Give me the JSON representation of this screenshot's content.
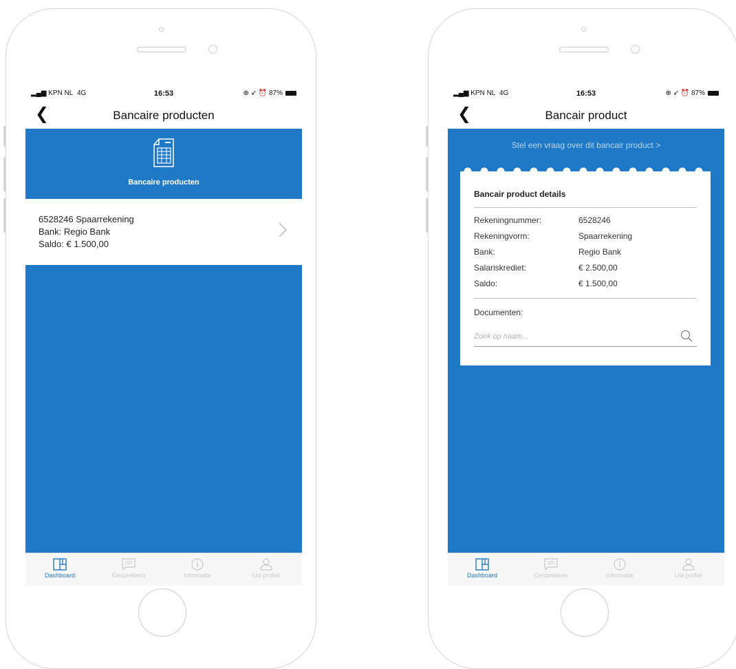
{
  "status_bar": {
    "carrier": "KPN NL",
    "network": "4G",
    "time": "16:53",
    "battery": "87%"
  },
  "left_screen": {
    "title": "Bancaire producten",
    "hero_label": "Bancaire producten",
    "hero_icon": "bank-statement-icon",
    "item": {
      "line1": "6528246  Spaarrekening",
      "line2": "Bank: Regio Bank",
      "line3": "Saldo: € 1.500,00"
    }
  },
  "right_screen": {
    "title": "Bancair product",
    "ask_link": "Stel een vraag over dit bancair product  >",
    "card_title": "Bancair product details",
    "details": [
      {
        "label": "Rekeningnummer:",
        "value": "6528246"
      },
      {
        "label": "Rekeningvorm:",
        "value": "Spaarrekening"
      },
      {
        "label": "Bank:",
        "value": "Regio Bank"
      },
      {
        "label": "Salariskrediet:",
        "value": "€ 2.500,00"
      },
      {
        "label": "Saldo:",
        "value": "€ 1.500,00"
      }
    ],
    "documents_label": "Documenten:",
    "search_placeholder": "Zoek op naam..."
  },
  "tab_bar": [
    {
      "label": "Dashboard",
      "icon": "dashboard-icon",
      "active": true
    },
    {
      "label": "Gesprekken",
      "icon": "chat-icon",
      "active": false
    },
    {
      "label": "Informatie",
      "icon": "info-icon",
      "active": false
    },
    {
      "label": "Uw profiel",
      "icon": "profile-icon",
      "active": false
    }
  ],
  "colors": {
    "primary": "#2079c6",
    "tab_inactive": "#c8c8c8",
    "link_light": "#b7d6f1"
  }
}
